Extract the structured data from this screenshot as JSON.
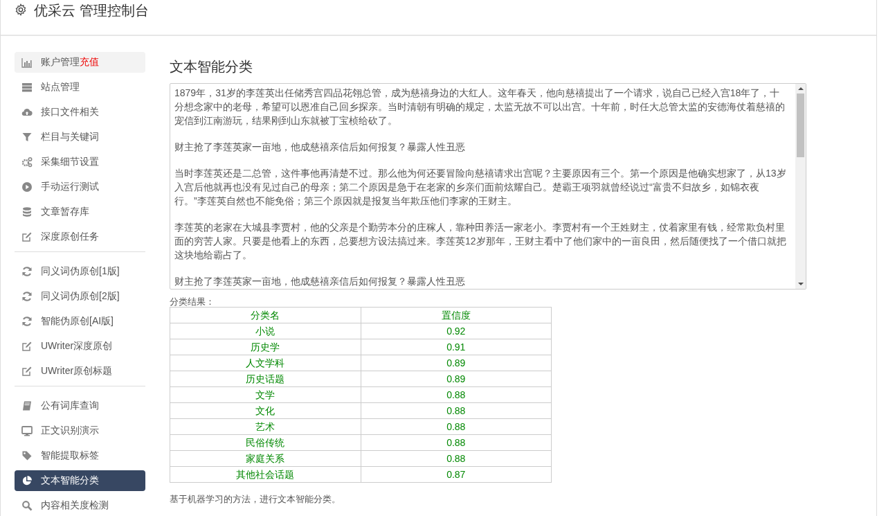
{
  "header": {
    "title": "优采云 管理控制台"
  },
  "sidebar": {
    "groups": [
      {
        "items": [
          {
            "label": "账户管理",
            "badge": "充值",
            "kind": "bars",
            "hovered": true,
            "selected": false
          },
          {
            "label": "站点管理",
            "kind": "server",
            "hovered": false,
            "selected": false
          },
          {
            "label": "接口文件相关",
            "kind": "cloud",
            "hovered": false,
            "selected": false
          },
          {
            "label": "栏目与关键词",
            "kind": "filter",
            "hovered": false,
            "selected": false
          },
          {
            "label": "采集细节设置",
            "kind": "gears",
            "hovered": false,
            "selected": false
          },
          {
            "label": "手动运行测试",
            "kind": "play",
            "hovered": false,
            "selected": false
          },
          {
            "label": "文章暂存库",
            "kind": "database",
            "hovered": false,
            "selected": false
          },
          {
            "label": "深度原创任务",
            "kind": "edit",
            "hovered": false,
            "selected": false
          }
        ]
      },
      {
        "items": [
          {
            "label": "同义词伪原创[1版]",
            "kind": "refresh",
            "hovered": false,
            "selected": false
          },
          {
            "label": "同义词伪原创[2版]",
            "kind": "refresh",
            "hovered": false,
            "selected": false
          },
          {
            "label": "智能伪原创[AI版]",
            "kind": "refresh",
            "hovered": false,
            "selected": false
          },
          {
            "label": "UWriter深度原创",
            "kind": "edit",
            "hovered": false,
            "selected": false
          },
          {
            "label": "UWriter原创标题",
            "kind": "edit",
            "hovered": false,
            "selected": false
          }
        ]
      },
      {
        "items": [
          {
            "label": "公有词库查询",
            "kind": "book",
            "hovered": false,
            "selected": false
          },
          {
            "label": "正文识别演示",
            "kind": "monitor",
            "hovered": false,
            "selected": false
          },
          {
            "label": "智能提取标签",
            "kind": "tag",
            "hovered": false,
            "selected": false
          },
          {
            "label": "文本智能分类",
            "kind": "pie",
            "hovered": false,
            "selected": true
          },
          {
            "label": "内容相关度检测",
            "kind": "search",
            "hovered": false,
            "selected": false
          }
        ]
      }
    ]
  },
  "main": {
    "title": "文本智能分类",
    "text_area": {
      "paragraphs": [
        "1879年，31岁的李莲英出任储秀宫四品花翎总管，成为慈禧身边的大红人。这年春天，他向慈禧提出了一个请求，说自己已经入宫18年了，十分想念家中的老母，希望可以恩准自己回乡探亲。当时清朝有明确的规定，太监无故不可以出宫。十年前，时任大总管太监的安德海仗着慈禧的宠信到江南游玩，结果刚到山东就被丁宝桢给砍了。",
        "财主抢了李莲英家一亩地，他成慈禧亲信后如何报复？暴露人性丑恶",
        "当时李莲英还是二总管，这件事他再清楚不过。那么他为何还要冒险向慈禧请求出宫呢？主要原因有三个。第一个原因是他确实想家了，从13岁入宫后他就再也没有见过自己的母亲；第二个原因是急于在老家的乡亲们面前炫耀自己。楚霸王项羽就曾经说过“富贵不归故乡，如锦衣夜行。”李莲英自然也不能免俗；第三个原因就是报复当年欺压他们李家的王财主。",
        "李莲英的老家在大城县李贾村，他的父亲是个勤劳本分的庄稼人，靠种田养活一家老小。李贾村有一个王姓财主，仗着家里有钱，经常欺负村里面的穷苦人家。只要是他看上的东西，总要想方设法搞过来。李莲英12岁那年，王财主看中了他们家中的一亩良田，然后随便找了一个借口就把这块地给霸占了。",
        "财主抢了李莲英家一亩地，他成慈禧亲信后如何报复？暴露人性丑恶"
      ]
    },
    "result_label": "分类结果：",
    "table": {
      "columns": [
        "分类名",
        "置信度"
      ],
      "rows": [
        [
          "小说",
          "0.92"
        ],
        [
          "历史学",
          "0.91"
        ],
        [
          "人文学科",
          "0.89"
        ],
        [
          "历史话题",
          "0.89"
        ],
        [
          "文学",
          "0.88"
        ],
        [
          "文化",
          "0.88"
        ],
        [
          "艺术",
          "0.88"
        ],
        [
          "民俗传统",
          "0.88"
        ],
        [
          "家庭关系",
          "0.88"
        ],
        [
          "其他社会话题",
          "0.87"
        ]
      ]
    },
    "note": "基于机器学习的方法，进行文本智能分类。"
  }
}
